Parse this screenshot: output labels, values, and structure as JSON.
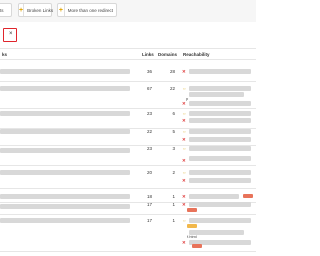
{
  "filters": [
    {
      "label": "ts"
    },
    {
      "label": "Broken Links"
    },
    {
      "label": "More than one redirect"
    }
  ],
  "active_filter": {
    "close_glyph": "×"
  },
  "table": {
    "headers": {
      "col1": "ks",
      "links": "Links",
      "domains": "Domains",
      "reachability": "Reachability"
    },
    "rows": [
      {
        "links": "36",
        "domains": "28"
      },
      {
        "links": "67",
        "domains": "22",
        "note": "p"
      },
      {
        "links": "23",
        "domains": "6"
      },
      {
        "links": "22",
        "domains": "5"
      },
      {
        "links": "23",
        "domains": "3"
      },
      {
        "links": "20",
        "domains": "2"
      },
      {
        "links": "18",
        "domains": "1"
      },
      {
        "links": "17",
        "domains": "1"
      },
      {
        "links": "17",
        "domains": "1",
        "note": "f.html"
      }
    ]
  },
  "colors": {
    "accent": "#e0a300",
    "error": "#d33333",
    "badge": "#e8735a"
  }
}
